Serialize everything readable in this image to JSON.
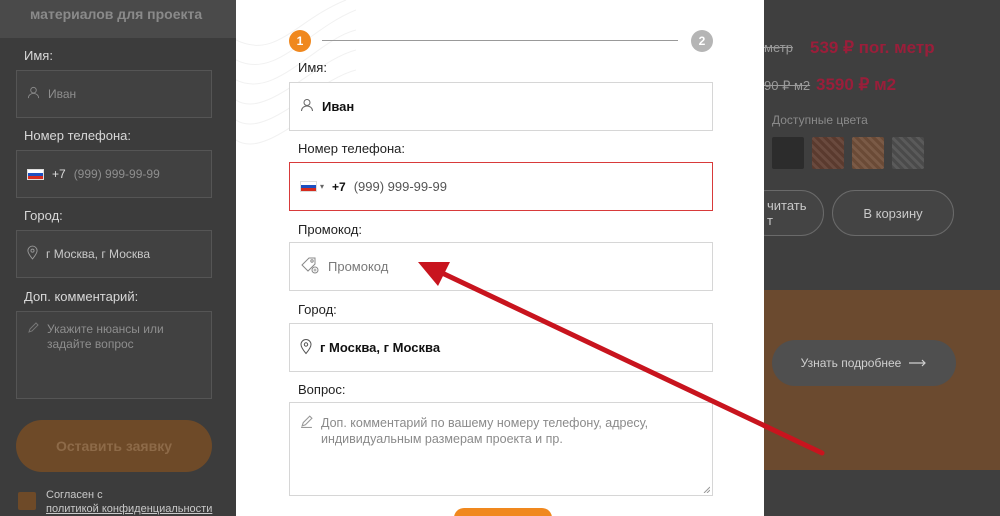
{
  "background_left": {
    "title": "материалов для проекта",
    "name_label": "Имя:",
    "name_placeholder": "Иван",
    "phone_label": "Номер телефона:",
    "phone_code": "+7",
    "phone_placeholder": "(999) 999-99-99",
    "city_label": "Город:",
    "city_value": "г Москва, г Москва",
    "comment_label": "Доп. комментарий:",
    "comment_placeholder_line1": "Укажите нюансы или",
    "comment_placeholder_line2": "задайте вопрос",
    "submit_label": "Оставить заявку",
    "agree_line1": "Согласен с",
    "agree_line2": "политикой конфиденциальности"
  },
  "background_right": {
    "price1_old": "метр",
    "price1_new": "539 ₽ пог. метр",
    "price2_old": "90 ₽ м2",
    "price2_new": "3590 ₽ м2",
    "colors_label": "Доступные цвета",
    "calc_label_line1": "читать",
    "calc_label_line2": "т",
    "cart_label": "В корзину",
    "more_label": "Узнать подробнее"
  },
  "modal": {
    "steps": [
      "1",
      "2"
    ],
    "name": {
      "label": "Имя:",
      "value": "Иван"
    },
    "phone": {
      "label": "Номер телефона:",
      "code": "+7",
      "placeholder": "(999) 999-99-99"
    },
    "promo": {
      "label": "Промокод:",
      "placeholder": "Промокод"
    },
    "city": {
      "label": "Город:",
      "value": "г Москва, г Москва"
    },
    "question": {
      "label": "Вопрос:",
      "placeholder_line1": "Доп. комментарий по вашему номеру телефону, адресу,",
      "placeholder_line2": "индивидуальным размерам проекта и пр."
    }
  },
  "icons": [
    "user-icon",
    "flag-ru-icon",
    "tag-icon",
    "location-pin-icon",
    "pencil-icon",
    "arrow-right-icon"
  ],
  "colors": {
    "accent": "#f0881e",
    "error": "#d83a3a",
    "price": "#9a1e3a",
    "annotation_arrow": "#c8141e"
  }
}
